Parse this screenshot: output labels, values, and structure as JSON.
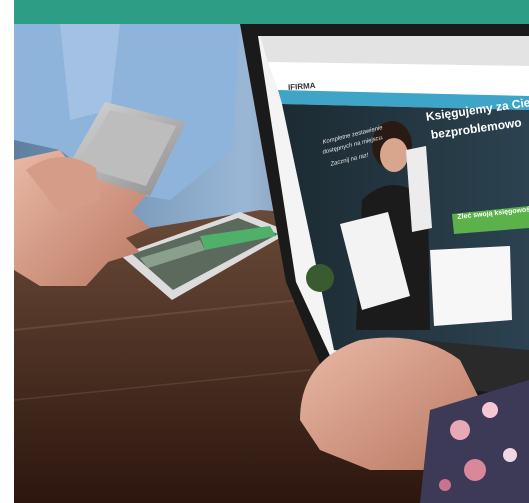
{
  "photo": {
    "banner_color": "#2e9d85",
    "table_color": "#4a2a1c",
    "site": {
      "logo": "IFIRMA",
      "headline_line1": "Księgujemy za Ciebie",
      "headline_line2": "bezproblemowo",
      "handwritten_line1": "Kompletne zestawienie",
      "handwritten_line2": "dostępnych na miejscu.",
      "handwritten_line3": "Zacznij na raz!",
      "cta_button": "Zleć swoją księgowość"
    }
  }
}
